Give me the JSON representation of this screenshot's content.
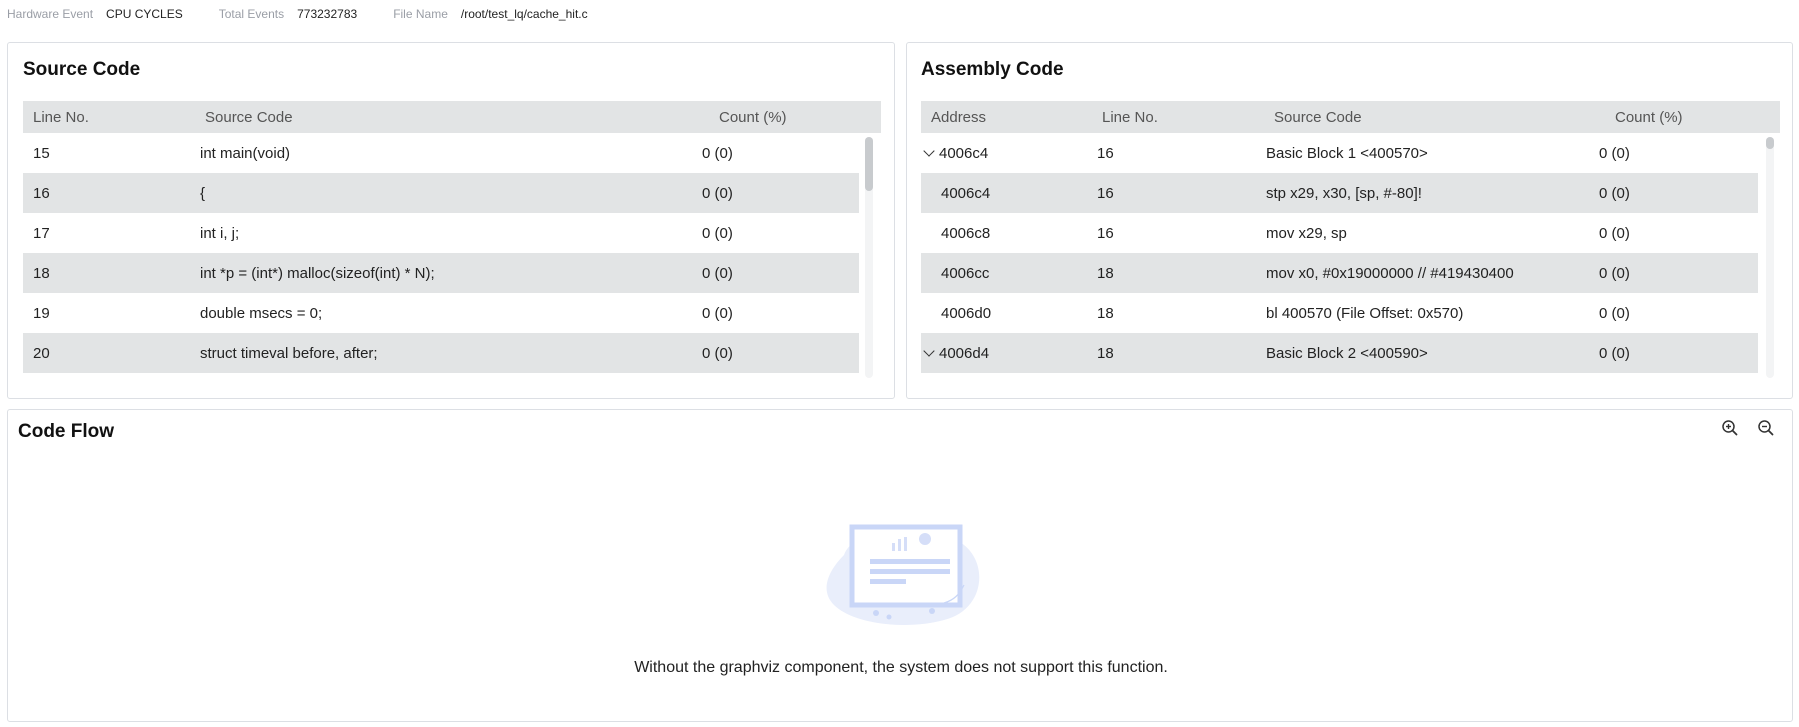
{
  "header": {
    "hardware_event_label": "Hardware Event",
    "hardware_event_value": "CPU CYCLES",
    "total_events_label": "Total Events",
    "total_events_value": "773232783",
    "file_name_label": "File Name",
    "file_name_value": "/root/test_lq/cache_hit.c"
  },
  "source_code": {
    "title": "Source Code",
    "columns": [
      "Line No.",
      "Source Code",
      "Count (%)"
    ],
    "rows": [
      {
        "line": "15",
        "code": "int main(void)",
        "count": "0 (0)"
      },
      {
        "line": "16",
        "code": "{",
        "count": "0 (0)"
      },
      {
        "line": "17",
        "code": "int i, j;",
        "count": "0 (0)"
      },
      {
        "line": "18",
        "code": "int *p = (int*) malloc(sizeof(int) * N);",
        "count": "0 (0)"
      },
      {
        "line": "19",
        "code": "double msecs = 0;",
        "count": "0 (0)"
      },
      {
        "line": "20",
        "code": "struct timeval before, after;",
        "count": "0 (0)"
      }
    ]
  },
  "assembly_code": {
    "title": "Assembly Code",
    "columns": [
      "Address",
      "Line No.",
      "Source Code",
      "Count (%)"
    ],
    "rows": [
      {
        "address": "4006c4",
        "line": "16",
        "code": "Basic Block 1 <400570>",
        "count": "0 (0)",
        "expandable": true
      },
      {
        "address": "4006c4",
        "line": "16",
        "code": "stp x29, x30, [sp, #-80]!",
        "count": "0 (0)",
        "expandable": false
      },
      {
        "address": "4006c8",
        "line": "16",
        "code": "mov x29, sp",
        "count": "0 (0)",
        "expandable": false
      },
      {
        "address": "4006cc",
        "line": "18",
        "code": "mov x0, #0x19000000 // #419430400",
        "count": "0 (0)",
        "expandable": false
      },
      {
        "address": "4006d0",
        "line": "18",
        "code": "bl 400570 (File Offset: 0x570)",
        "count": "0 (0)",
        "expandable": false
      },
      {
        "address": "4006d4",
        "line": "18",
        "code": "Basic Block 2 <400590>",
        "count": "0 (0)",
        "expandable": true
      }
    ]
  },
  "code_flow": {
    "title": "Code Flow",
    "empty_message": "Without the graphviz component, the system does not support this function.",
    "icons": [
      "zoom-in-icon",
      "zoom-out-icon"
    ]
  },
  "colors": {
    "header_bg": "#e2e4e5",
    "alt_row_bg": "#e2e4e5",
    "illustration": "#c9d6f7",
    "label_grey": "#9a9ea6"
  }
}
